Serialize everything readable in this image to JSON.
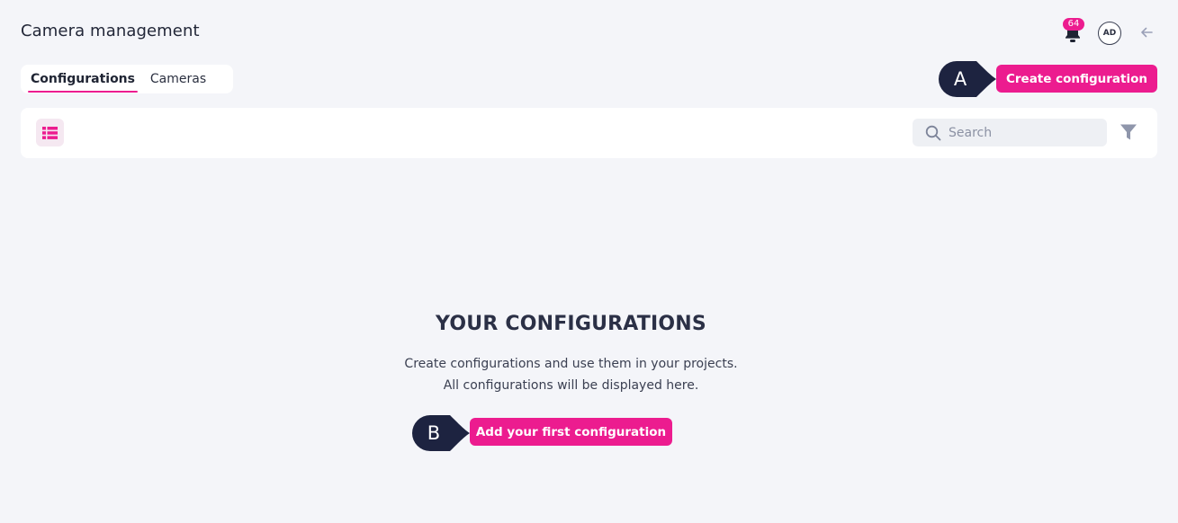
{
  "header": {
    "title": "Camera management",
    "notifications_count": "64",
    "avatar_initials": "AD"
  },
  "tabs": [
    {
      "label": "Configurations",
      "active": true
    },
    {
      "label": "Cameras",
      "active": false
    }
  ],
  "actions": {
    "create_label": "Create configuration"
  },
  "markers": {
    "a": "A",
    "b": "B"
  },
  "toolbar": {
    "search_placeholder": "Search"
  },
  "empty_state": {
    "title": "YOUR CONFIGURATIONS",
    "line1": "Create configurations and use them in your projects.",
    "line2": "All configurations will be displayed here.",
    "button_label": "Add your first configuration"
  },
  "icons": {
    "bell": "bell-icon",
    "back": "arrow-left-icon",
    "list": "list-view-icon",
    "search": "search-icon",
    "filter": "filter-icon"
  },
  "colors": {
    "accent": "#ec1c8f",
    "marker": "#1d2340",
    "background": "#f4f5f9"
  }
}
